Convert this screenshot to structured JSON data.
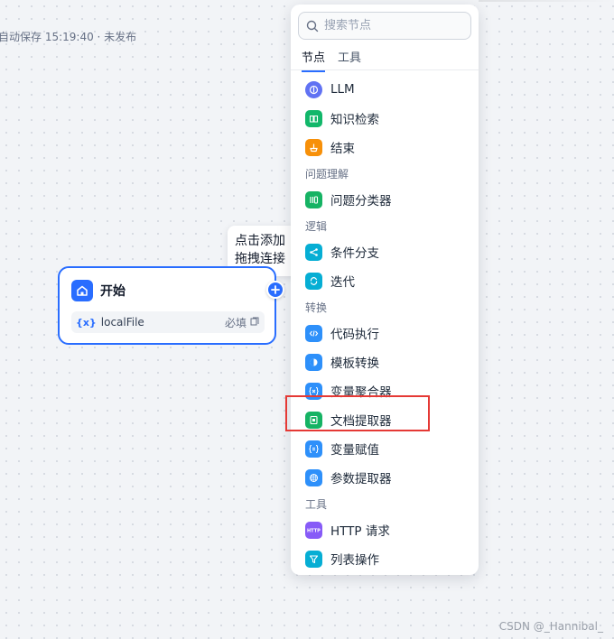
{
  "header": {
    "autosave_text": "自动保存 15:19:40 · 未发布"
  },
  "tooltip": {
    "line1": "点击添加",
    "line2": "拖拽连接"
  },
  "start_node": {
    "title": "开始",
    "variable": {
      "prefix": "{x}",
      "name": "localFile",
      "required_label": "必填"
    }
  },
  "panel": {
    "search_placeholder": "搜索节点",
    "tabs": [
      "节点",
      "工具"
    ],
    "active_tab": "节点",
    "items": {
      "llm": "LLM",
      "knowledge": "知识检索",
      "end": "结束",
      "cat_question": "问题理解",
      "classifier": "问题分类器",
      "cat_logic": "逻辑",
      "ifelse": "条件分支",
      "iteration": "迭代",
      "cat_transform": "转换",
      "code": "代码执行",
      "template": "模板转换",
      "aggregator": "变量聚合器",
      "doc_extractor": "文档提取器",
      "assigner": "变量赋值",
      "param_extractor": "参数提取器",
      "cat_tools": "工具",
      "http": "HTTP 请求",
      "list_op": "列表操作"
    }
  },
  "colors": {
    "accent": "#296dff",
    "llm": "#6172f3",
    "knowledge": "#12b76a",
    "end": "#f79009",
    "classifier": "#16b364",
    "ifelse": "#06aed4",
    "iteration": "#06aed4",
    "code": "#2e90fa",
    "template": "#2e90fa",
    "aggregator": "#2e90fa",
    "doc_extractor": "#16b364",
    "assigner": "#2e90fa",
    "param_extractor": "#2e90fa",
    "http": "#875bf7",
    "list_op": "#06aed4",
    "highlight_box": "#e53935"
  },
  "watermark": "CSDN @_Hannibal_"
}
